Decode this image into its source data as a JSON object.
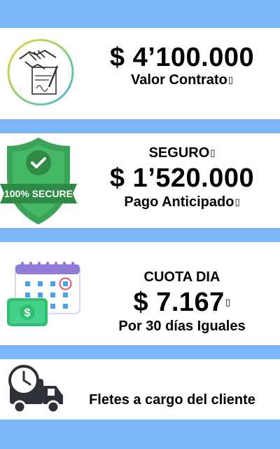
{
  "colors": {
    "stripe": "#7cb6f6",
    "shield_green": "#3aa357",
    "banner_green": "#2e8b46",
    "money_green": "#2fbf73",
    "calendar_purple": "#8f7ad8",
    "calendar_blue": "#4aa3e8",
    "calendar_dot": "#e0527a",
    "truck_dark": "#2d3138"
  },
  "cards": [
    {
      "icon": "contract-handshake-icon",
      "title": "$ 4’100.000",
      "subtitle": "Valor Contrato",
      "subtitle_suffix": "▯"
    },
    {
      "icon": "secure-shield-icon",
      "badge_text": "100% SECURE",
      "heading": "SEGURO",
      "heading_suffix": "▯",
      "title": "$ 1’520.000",
      "subtitle": "Pago Anticipado",
      "subtitle_suffix": "▯"
    },
    {
      "icon": "calendar-money-icon",
      "heading": "CUOTA DIA",
      "title": "$ 7.167",
      "title_suffix": "▯",
      "money_symbol": "$",
      "subtitle": "Por 30 días Iguales"
    },
    {
      "icon": "delivery-truck-clock-icon",
      "subtitle": "Fletes a cargo del cliente"
    }
  ]
}
